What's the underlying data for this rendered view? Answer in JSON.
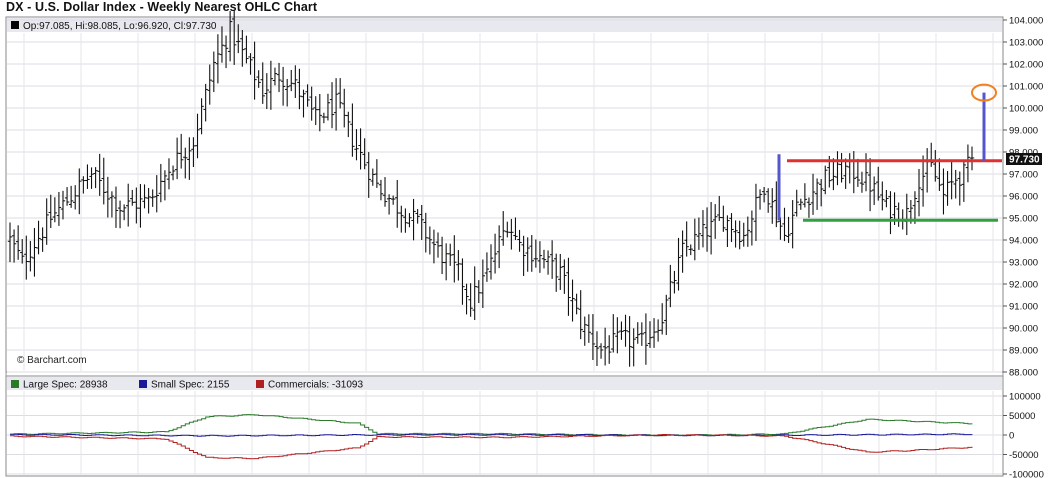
{
  "chart_title": "DX - U.S. Dollar Index - Weekly Nearest OHLC Chart",
  "watermark": "© Barchart.com",
  "price_panel": {
    "header_label": "Op:97.085, Hi:98.085, Lo:96.920, Cl:97.730",
    "last_close_label": "97.730",
    "last_close": 97.73,
    "axis_min": 88.0,
    "axis_max": 104.0,
    "tick_labels": [
      "104.000",
      "103.000",
      "102.000",
      "101.000",
      "100.000",
      "99.000",
      "98.000",
      "97.000",
      "96.000",
      "95.000",
      "94.000",
      "93.000",
      "92.000",
      "91.000",
      "90.000",
      "89.000",
      "88.000"
    ]
  },
  "annotations": {
    "resistance_level": 97.6,
    "support_level": 94.9,
    "resistance_color": "#e03030",
    "support_color": "#30a040",
    "range_color": "#5555cc",
    "target_color": "#f08020",
    "target_level": 100.7
  },
  "cot_panel": {
    "legend": [
      {
        "name": "Large Spec: 28938",
        "color": "#2a7a2a"
      },
      {
        "name": "Small Spec: 2155",
        "color": "#1a1a99"
      },
      {
        "name": "Commercials: -31093",
        "color": "#b02020"
      }
    ],
    "tick_labels": [
      "100000",
      "50000",
      "0",
      "-50000",
      "-100000"
    ],
    "axis_min": -100000,
    "axis_max": 100000
  },
  "chart_data": [
    {
      "type": "ohlc",
      "title": "DX - U.S. Dollar Index - Weekly Nearest OHLC Chart",
      "ylim": [
        88,
        104
      ],
      "x": "weekly bars (approx. 237 weeks shown)",
      "close_path_keypoints": [
        [
          0,
          94.0
        ],
        [
          3,
          93.0
        ],
        [
          10,
          95.0
        ],
        [
          15,
          96.0
        ],
        [
          20,
          97.0
        ],
        [
          27,
          95.5
        ],
        [
          34,
          95.8
        ],
        [
          40,
          97.5
        ],
        [
          45,
          98.5
        ],
        [
          50,
          102.0
        ],
        [
          54,
          103.5
        ],
        [
          57,
          102.5
        ],
        [
          62,
          100.8
        ],
        [
          66,
          101.5
        ],
        [
          70,
          101.0
        ],
        [
          75,
          99.5
        ],
        [
          80,
          100.2
        ],
        [
          85,
          98.2
        ],
        [
          90,
          96.5
        ],
        [
          95,
          95.5
        ],
        [
          100,
          94.8
        ],
        [
          105,
          93.5
        ],
        [
          110,
          92.5
        ],
        [
          113,
          91.2
        ],
        [
          117,
          92.5
        ],
        [
          122,
          94.8
        ],
        [
          125,
          93.8
        ],
        [
          130,
          93.2
        ],
        [
          135,
          92.5
        ],
        [
          140,
          90.2
        ],
        [
          145,
          89.0
        ],
        [
          150,
          89.5
        ],
        [
          155,
          89.3
        ],
        [
          160,
          90.5
        ],
        [
          165,
          93.5
        ],
        [
          170,
          94.3
        ],
        [
          175,
          95.0
        ],
        [
          180,
          94.2
        ],
        [
          185,
          96.5
        ],
        [
          190,
          94.2
        ],
        [
          193,
          95.5
        ],
        [
          200,
          96.8
        ],
        [
          205,
          97.2
        ],
        [
          208,
          97.0
        ],
        [
          211,
          96.5
        ],
        [
          215,
          95.5
        ],
        [
          220,
          95.2
        ],
        [
          223,
          96.8
        ],
        [
          226,
          97.3
        ],
        [
          229,
          96.0
        ],
        [
          232,
          96.8
        ],
        [
          234,
          97.0
        ],
        [
          236,
          97.73
        ]
      ]
    },
    {
      "type": "line",
      "title": "",
      "ylim": [
        -100000,
        100000
      ],
      "series": [
        {
          "name": "Large Spec: 28938",
          "keypoints": [
            [
              0,
              2000
            ],
            [
              38,
              8000
            ],
            [
              48,
              47000
            ],
            [
              60,
              52000
            ],
            [
              85,
              30000
            ],
            [
              90,
              3000
            ],
            [
              120,
              3000
            ],
            [
              160,
              -1000
            ],
            [
              180,
              1000
            ],
            [
              190,
              3000
            ],
            [
              195,
              13000
            ],
            [
              210,
              40000
            ],
            [
              220,
              36000
            ],
            [
              236,
              28938
            ]
          ]
        },
        {
          "name": "Small Spec: 2155",
          "keypoints": [
            [
              0,
              1000
            ],
            [
              50,
              -2000
            ],
            [
              100,
              1000
            ],
            [
              140,
              0
            ],
            [
              180,
              -1000
            ],
            [
              236,
              2155
            ]
          ]
        },
        {
          "name": "Commercials: -31093",
          "keypoints": [
            [
              0,
              -3000
            ],
            [
              38,
              -10000
            ],
            [
              48,
              -58000
            ],
            [
              60,
              -60000
            ],
            [
              85,
              -33000
            ],
            [
              90,
              -5000
            ],
            [
              120,
              -6000
            ],
            [
              160,
              0
            ],
            [
              180,
              -1000
            ],
            [
              190,
              -3000
            ],
            [
              195,
              -13000
            ],
            [
              210,
              -44000
            ],
            [
              220,
              -40000
            ],
            [
              236,
              -31093
            ]
          ]
        }
      ]
    }
  ]
}
